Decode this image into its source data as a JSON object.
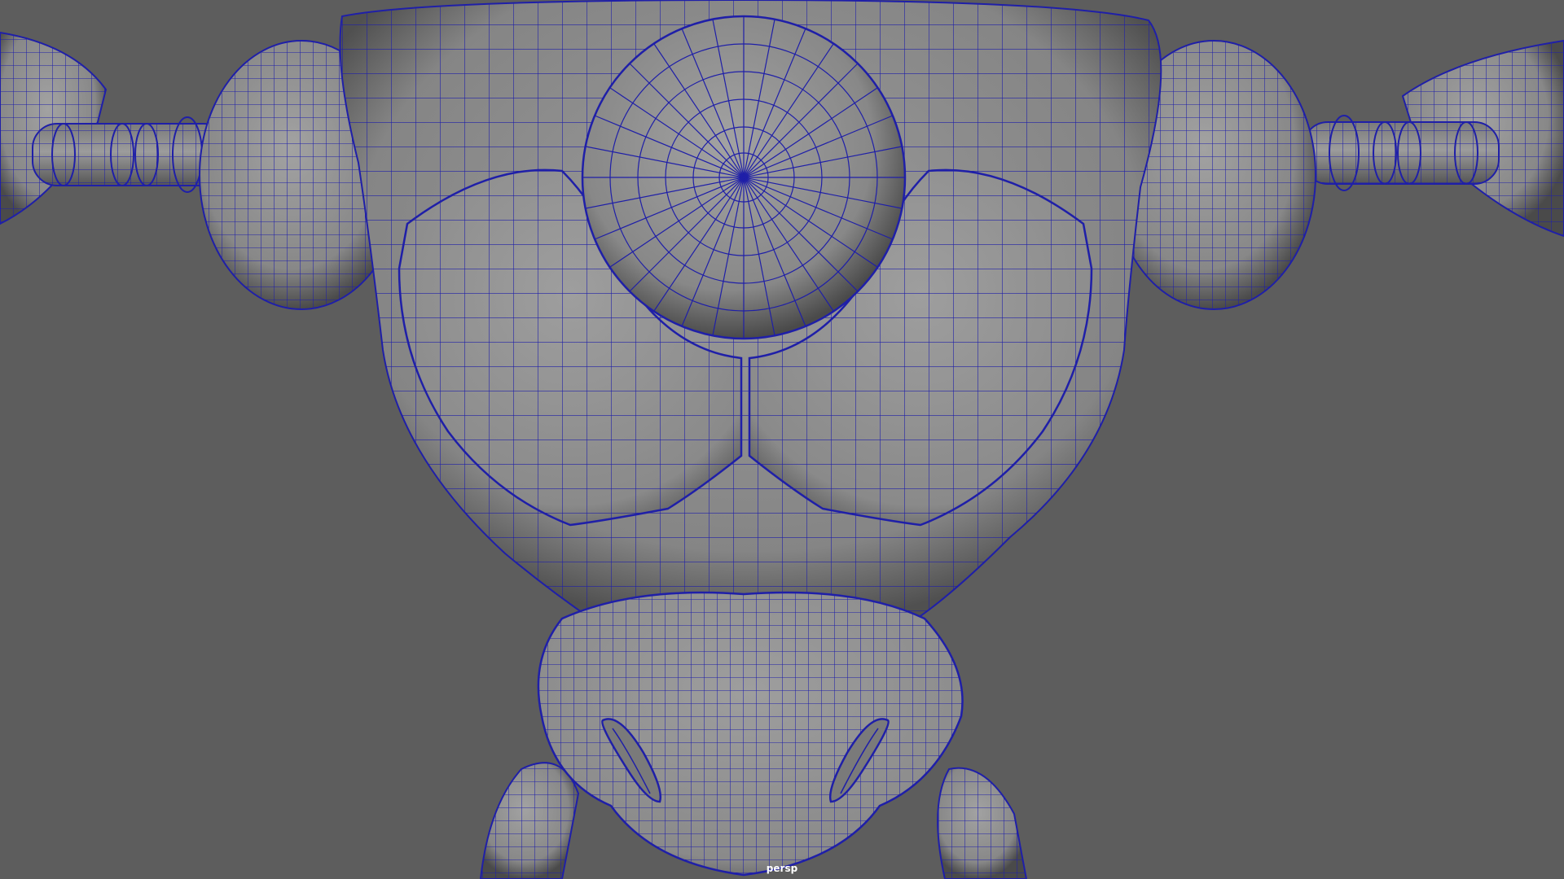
{
  "viewport": {
    "camera": "persp",
    "background_color": "#5d5d5d",
    "mesh_color": "#8d8d8d",
    "wireframe_color": "#1f1fa8"
  }
}
